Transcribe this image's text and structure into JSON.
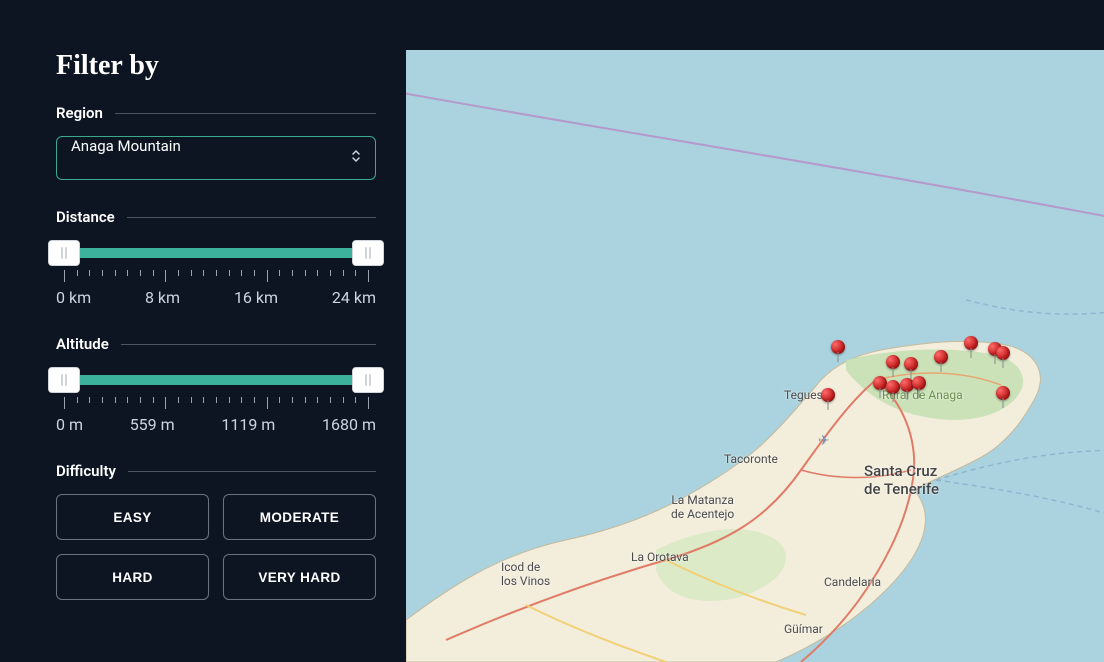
{
  "title": "Filter by",
  "region": {
    "label": "Region",
    "selected": "Anaga Mountain"
  },
  "distance": {
    "label": "Distance",
    "min": 0,
    "max": 24,
    "ticks": [
      "0 km",
      "8 km",
      "16 km",
      "24 km"
    ]
  },
  "altitude": {
    "label": "Altitude",
    "min": 0,
    "max": 1680,
    "ticks": [
      "0 m",
      "559 m",
      "1119 m",
      "1680 m"
    ]
  },
  "difficulty": {
    "label": "Difficulty",
    "options": [
      "EASY",
      "MODERATE",
      "HARD",
      "VERY HARD"
    ]
  },
  "map": {
    "towns": {
      "tegueste": "Tegueste",
      "tacoronte": "Tacoronte",
      "matanza": "La Matanza\nde Acentejo",
      "cruz": "Santa Cruz\nde Tenerife",
      "orotava": "La Orotava",
      "icod": "Icod de\nlos Vinos",
      "candelaria": "Candelaria",
      "guimar": "Güímar",
      "rural": "Rural de Anaga"
    },
    "pins": 13
  }
}
